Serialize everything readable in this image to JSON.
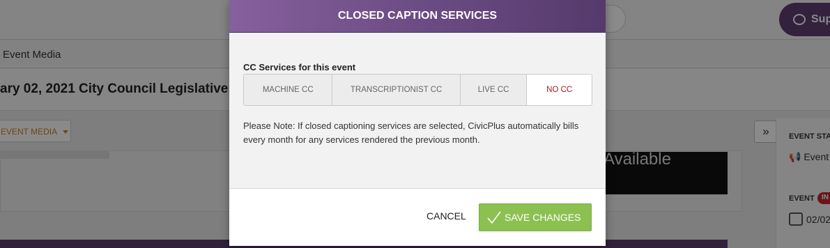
{
  "background": {
    "support_label": "Sup",
    "breadcrumb": "Event Media",
    "event_title": "ary 02, 2021 City Council Legislative S",
    "media_button": "EVENT MEDIA",
    "video_text": "Available",
    "expand_glyph": "»",
    "side": {
      "status_label": "EVENT STA",
      "status_value": "Event",
      "event_label": "EVENT",
      "event_badge": "IN",
      "date_value": "02/02"
    }
  },
  "modal": {
    "title": "CLOSED CAPTION SERVICES",
    "cc_label": "CC Services for this event",
    "options": [
      {
        "label": "MACHINE CC",
        "selected": false
      },
      {
        "label": "TRANSCRIPTIONIST CC",
        "selected": false
      },
      {
        "label": "LIVE CC",
        "selected": false
      },
      {
        "label": "NO CC",
        "selected": true
      }
    ],
    "note": "Please Note: If closed captioning services are selected, CivicPlus automatically bills every month for any services rendered the previous month.",
    "cancel_label": "CANCEL",
    "save_label": "SAVE CHANGES"
  },
  "colors": {
    "header_purple": "#6a4a82",
    "save_green": "#8cc152",
    "selected_red": "#a01c1c"
  }
}
